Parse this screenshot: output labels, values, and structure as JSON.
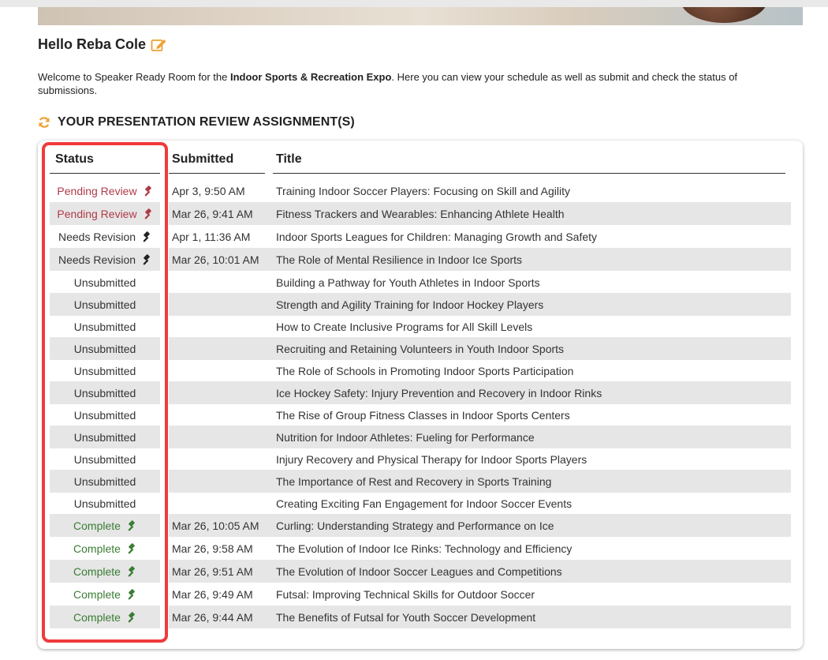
{
  "greeting": "Hello Reba Cole",
  "welcome": {
    "prefix": "Welcome to Speaker Ready Room for the ",
    "event": "Indoor Sports & Recreation Expo",
    "suffix": ". Here you can view your schedule as well as submit and check the status of submissions."
  },
  "section_title": "YOUR PRESENTATION REVIEW ASSIGNMENT(S)",
  "columns": {
    "status": "Status",
    "submitted": "Submitted",
    "title": "Title"
  },
  "colors": {
    "pending": "#b03a48",
    "revision": "#333333",
    "complete": "#3a7d34",
    "accent": "#f0a030",
    "highlight": "#ef3b3b"
  },
  "rows": [
    {
      "status": "Pending Review",
      "type": "pending",
      "submitted": "Apr 3, 9:50 AM",
      "title": "Training Indoor Soccer Players: Focusing on Skill and Agility"
    },
    {
      "status": "Pending Review",
      "type": "pending",
      "submitted": "Mar 26, 9:41 AM",
      "title": "Fitness Trackers and Wearables: Enhancing Athlete Health"
    },
    {
      "status": "Needs Revision",
      "type": "revision",
      "submitted": "Apr 1, 11:36 AM",
      "title": "Indoor Sports Leagues for Children: Managing Growth and Safety"
    },
    {
      "status": "Needs Revision",
      "type": "revision",
      "submitted": "Mar 26, 10:01 AM",
      "title": "The Role of Mental Resilience in Indoor Ice Sports"
    },
    {
      "status": "Unsubmitted",
      "type": "unsub",
      "submitted": "",
      "title": "Building a Pathway for Youth Athletes in Indoor Sports"
    },
    {
      "status": "Unsubmitted",
      "type": "unsub",
      "submitted": "",
      "title": "Strength and Agility Training for Indoor Hockey Players"
    },
    {
      "status": "Unsubmitted",
      "type": "unsub",
      "submitted": "",
      "title": "How to Create Inclusive Programs for All Skill Levels"
    },
    {
      "status": "Unsubmitted",
      "type": "unsub",
      "submitted": "",
      "title": "Recruiting and Retaining Volunteers in Youth Indoor Sports"
    },
    {
      "status": "Unsubmitted",
      "type": "unsub",
      "submitted": "",
      "title": "The Role of Schools in Promoting Indoor Sports Participation"
    },
    {
      "status": "Unsubmitted",
      "type": "unsub",
      "submitted": "",
      "title": "Ice Hockey Safety: Injury Prevention and Recovery in Indoor Rinks"
    },
    {
      "status": "Unsubmitted",
      "type": "unsub",
      "submitted": "",
      "title": "The Rise of Group Fitness Classes in Indoor Sports Centers"
    },
    {
      "status": "Unsubmitted",
      "type": "unsub",
      "submitted": "",
      "title": "Nutrition for Indoor Athletes: Fueling for Performance"
    },
    {
      "status": "Unsubmitted",
      "type": "unsub",
      "submitted": "",
      "title": "Injury Recovery and Physical Therapy for Indoor Sports Players"
    },
    {
      "status": "Unsubmitted",
      "type": "unsub",
      "submitted": "",
      "title": "The Importance of Rest and Recovery in Sports Training"
    },
    {
      "status": "Unsubmitted",
      "type": "unsub",
      "submitted": "",
      "title": "Creating Exciting Fan Engagement for Indoor Soccer Events"
    },
    {
      "status": "Complete",
      "type": "complete",
      "submitted": "Mar 26, 10:05 AM",
      "title": "Curling: Understanding Strategy and Performance on Ice"
    },
    {
      "status": "Complete",
      "type": "complete",
      "submitted": "Mar 26, 9:58 AM",
      "title": "The Evolution of Indoor Ice Rinks: Technology and Efficiency"
    },
    {
      "status": "Complete",
      "type": "complete",
      "submitted": "Mar 26, 9:51 AM",
      "title": "The Evolution of Indoor Soccer Leagues and Competitions"
    },
    {
      "status": "Complete",
      "type": "complete",
      "submitted": "Mar 26, 9:49 AM",
      "title": "Futsal: Improving Technical Skills for Outdoor Soccer"
    },
    {
      "status": "Complete",
      "type": "complete",
      "submitted": "Mar 26, 9:44 AM",
      "title": "The Benefits of Futsal for Youth Soccer Development"
    }
  ]
}
